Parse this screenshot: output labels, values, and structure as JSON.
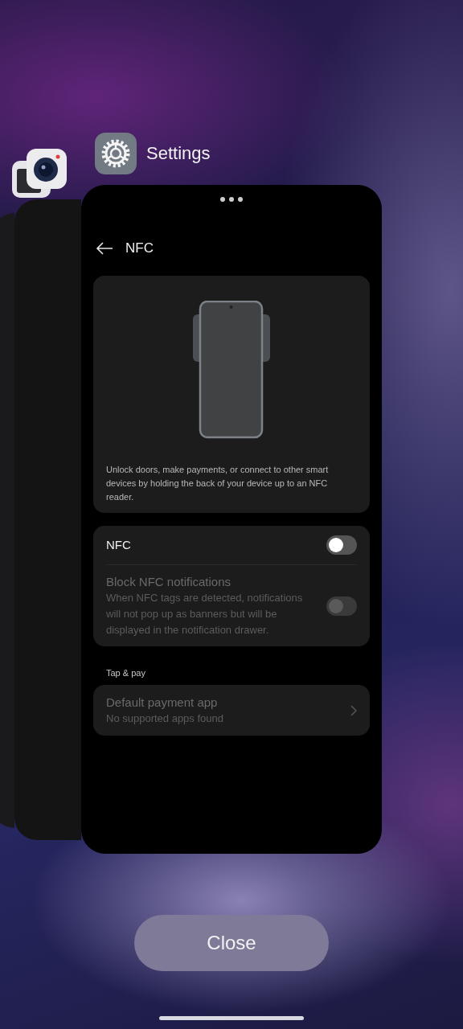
{
  "app_label": "Settings",
  "screen": {
    "title": "NFC",
    "caption": "Unlock doors, make payments, or connect to other smart devices by holding the back of your device up to an NFC reader.",
    "settings": [
      {
        "kind": "toggle",
        "label": "NFC",
        "on": false,
        "disabled": false
      },
      {
        "kind": "toggle",
        "label": "Block NFC notifications",
        "description": "When NFC tags are detected, notifications will not pop up as banners but will be displayed in the notification drawer.",
        "on": false,
        "disabled": true
      }
    ],
    "section_header": "Tap & pay",
    "link_rows": [
      {
        "label": "Default payment app",
        "description": "No supported apps found",
        "disabled": true
      }
    ]
  },
  "close_button": "Close"
}
